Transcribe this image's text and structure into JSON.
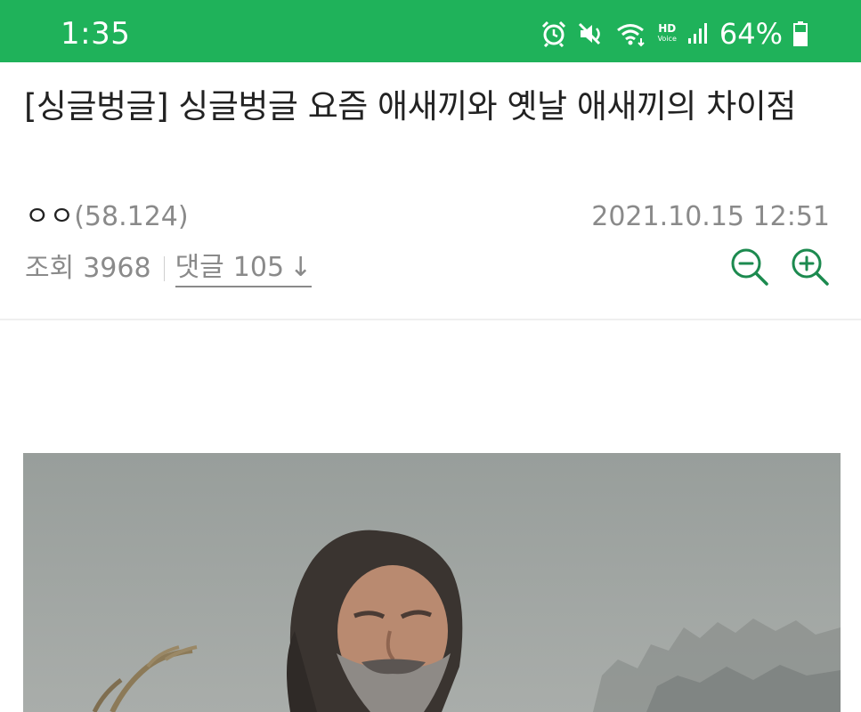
{
  "status_bar": {
    "time": "1:35",
    "hd_label": "HD",
    "voice_label": "Voice",
    "battery": "64%",
    "icons": [
      "alarm-icon",
      "mute-icon",
      "wifi-icon",
      "hd-voice-icon",
      "signal-icon",
      "battery-icon"
    ]
  },
  "post": {
    "title": "[싱글벙글] 싱글벙글 요즘 애새끼와 옛날 애새끼의 차이점",
    "author": "ㅇㅇ",
    "author_ip": "(58.124)",
    "date": "2021.10.15 12:51",
    "views_label": "조회",
    "views": "3968",
    "comments_label": "댓글",
    "comments": "105",
    "comments_arrow": "↓"
  },
  "colors": {
    "statusbar": "#1fb25a",
    "accent_green": "#1c8a4f",
    "muted_text": "#8a8a8a"
  },
  "zoom": {
    "out_icon": "zoom-out-icon",
    "in_icon": "zoom-in-icon"
  }
}
